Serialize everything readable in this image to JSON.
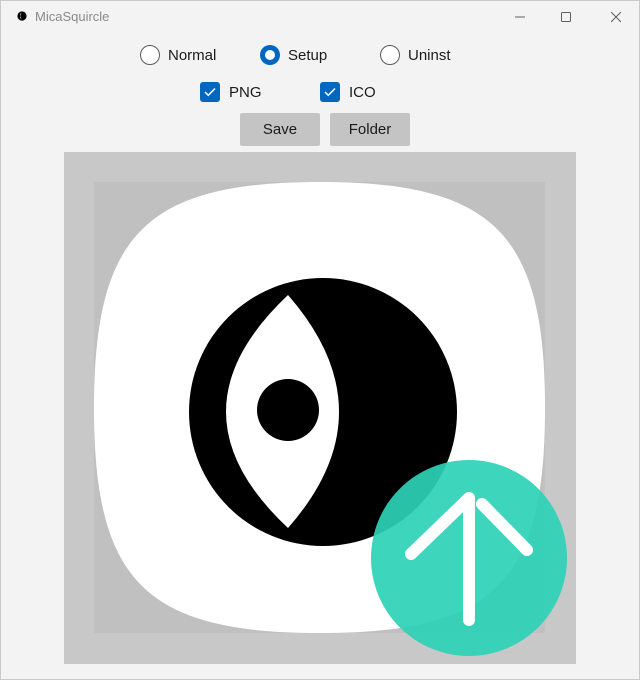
{
  "window": {
    "title": "MicaSquircle",
    "icon": "app-moon-icon",
    "controls": [
      "minimize-icon",
      "maximize-icon",
      "close-icon"
    ]
  },
  "mode": {
    "options": [
      {
        "label": "Normal",
        "checked": false
      },
      {
        "label": "Setup",
        "checked": true
      },
      {
        "label": "Uninst",
        "checked": false
      }
    ]
  },
  "formats": [
    {
      "label": "PNG",
      "checked": true
    },
    {
      "label": "ICO",
      "checked": true
    }
  ],
  "actions": {
    "save_label": "Save",
    "folder_label": "Folder"
  },
  "preview": {
    "icon": "squircle-eye-icon",
    "overlay": "up-arrow-badge-icon",
    "colors": {
      "canvas": "#c8c8c8",
      "safe_area": "#c0c0c0",
      "squircle": "#ffffff",
      "glyph": "#000000",
      "badge": "#2ed1b7"
    }
  },
  "colors": {
    "accent": "#0067c0",
    "window_bg": "#f3f3f3",
    "button_bg": "#c4c4c4"
  }
}
